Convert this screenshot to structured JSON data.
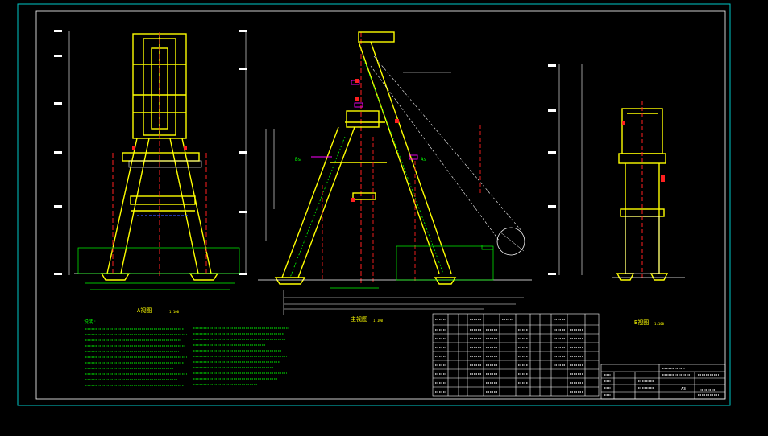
{
  "drawing": {
    "background": "#000000",
    "frame_color": "#00c8c8",
    "colors": {
      "structure": "#ffff00",
      "centerline": "#ff2020",
      "dimension": "#00ff00",
      "text": "#ffffff",
      "cyan": "#00ffff",
      "magenta": "#ff00ff",
      "blue": "#3050ff",
      "green": "#00ff00"
    }
  },
  "views": {
    "left_title": "A视图",
    "left_scale": "1:100",
    "middle_title": "主视图",
    "middle_scale": "1:100",
    "right_title": "B视图",
    "right_scale": "1:100"
  },
  "markers": {
    "left_marker": "Bs",
    "right_marker": "As"
  },
  "notes": {
    "heading": "说明:"
  },
  "title_block": {
    "sheet": "A3"
  }
}
